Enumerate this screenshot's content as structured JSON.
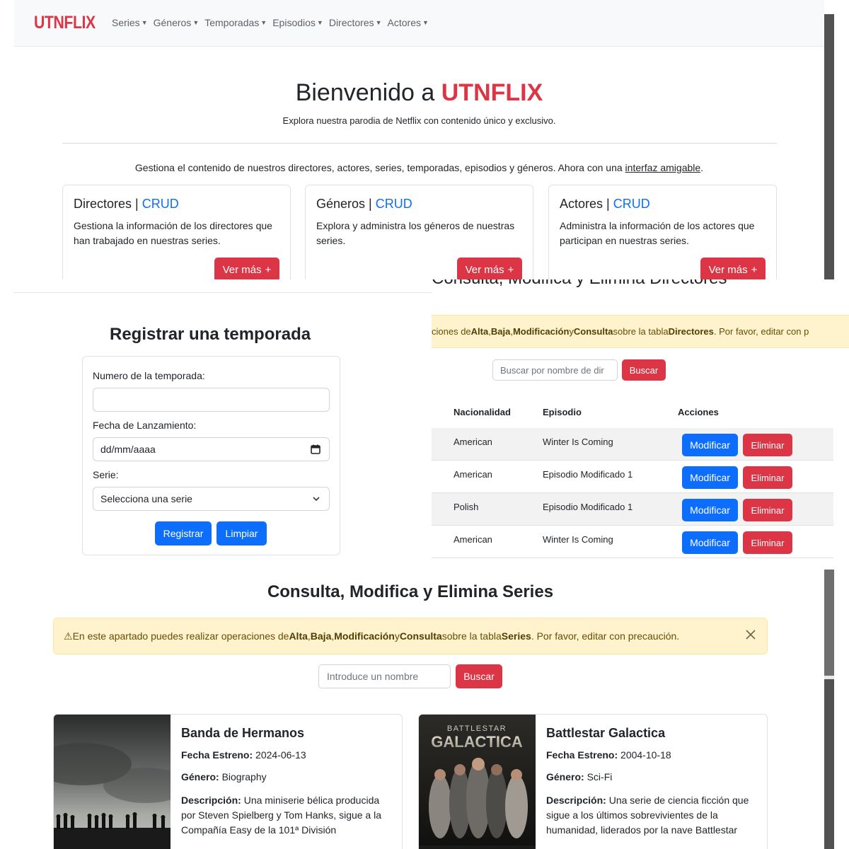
{
  "home": {
    "brand": "UTNFLIX",
    "nav": [
      {
        "label": "Series"
      },
      {
        "label": "Géneros"
      },
      {
        "label": "Temporadas"
      },
      {
        "label": "Episodios"
      },
      {
        "label": "Directores"
      },
      {
        "label": "Actores"
      }
    ],
    "hero_title_prefix": "Bienvenido a ",
    "hero_title_brand": "UTNFLIX",
    "hero_subtitle": "Explora nuestra parodia de Netflix con contenido único y exclusivo.",
    "description_prefix": "Gestiona el contenido de nuestros directores, actores, series, temporadas, episodios y géneros. Ahora con una ",
    "description_link": "interfaz amigable",
    "description_suffix": ".",
    "cards": [
      {
        "title": "Directores",
        "separator": " | ",
        "crud": "CRUD",
        "text": "Gestiona la información de los directores que han trabajado en nuestras series.",
        "button": "Ver más"
      },
      {
        "title": "Géneros",
        "separator": " | ",
        "crud": "CRUD",
        "text": "Explora y administra los géneros de nuestras series.",
        "button": "Ver más"
      },
      {
        "title": "Actores",
        "separator": " | ",
        "crud": "CRUD",
        "text": "Administra la información de los actores que participan en nuestras series.",
        "button": "Ver más"
      }
    ]
  },
  "temporada_form": {
    "title": "Registrar una temporada",
    "numero_label": "Numero de la temporada:",
    "numero_value": "",
    "fecha_label": "Fecha de Lanzamiento:",
    "fecha_placeholder": "dd/mm/aaaa",
    "serie_label": "Serie:",
    "serie_selected": "Selecciona una serie",
    "register_button": "Registrar",
    "clear_button": "Limpiar"
  },
  "directores": {
    "title_partial": "Consulta, Modifica y Elimina Directores",
    "alert_parts": {
      "p1": "ciones de ",
      "alta": "Alta",
      "c1": ", ",
      "baja": "Baja",
      "c2": ", ",
      "mod": "Modificación",
      "y": " y ",
      "consulta": "Consulta",
      "p2": " sobre la tabla ",
      "tabla": "Directores",
      "p3": ". Por favor, editar con p"
    },
    "search_placeholder": "Buscar por nombre de dir",
    "search_button": "Buscar",
    "columns": [
      "Nacionalidad",
      "Episodio",
      "Acciones"
    ],
    "rows": [
      {
        "nacionalidad": "American",
        "episodio": "Winter Is Coming",
        "modify": "Modificar",
        "delete": "Eliminar"
      },
      {
        "nacionalidad": "American",
        "episodio": "Episodio Modificado 1",
        "modify": "Modificar",
        "delete": "Eliminar"
      },
      {
        "nacionalidad": "Polish",
        "episodio": "Episodio Modificado 1",
        "modify": "Modificar",
        "delete": "Eliminar"
      },
      {
        "nacionalidad": "American",
        "episodio": "Winter Is Coming",
        "modify": "Modificar",
        "delete": "Eliminar"
      }
    ]
  },
  "series": {
    "title": "Consulta, Modifica y Elimina Series",
    "alert_parts": {
      "icon": "⚠",
      "p1": " En este apartado puedes realizar operaciones de ",
      "alta": "Alta",
      "c1": ", ",
      "baja": "Baja",
      "c2": ", ",
      "mod": "Modificación",
      "y": " y ",
      "consulta": "Consulta",
      "p2": " sobre la tabla ",
      "tabla": "Series",
      "p3": ". Por favor, editar con precaución."
    },
    "search_placeholder": "Introduce un nombre",
    "search_button": "Buscar",
    "cards": [
      {
        "name": "Banda de Hermanos",
        "fecha_label": "Fecha Estreno:",
        "fecha": " 2024-06-13",
        "genero_label": "Género:",
        "genero": " Biography",
        "desc_label": "Descripción:",
        "desc": " Una miniserie bélica producida por Steven Spielberg y Tom Hanks, sigue a la Compañía Easy de la 101ª División"
      },
      {
        "name": "Battlestar Galactica",
        "fecha_label": "Fecha Estreno:",
        "fecha": " 2004-10-18",
        "genero_label": "Género:",
        "genero": " Sci-Fi",
        "desc_label": "Descripción:",
        "desc": " Una serie de ciencia ficción que sigue a los últimos sobrevivientes de la humanidad, liderados por la nave Battlestar",
        "poster_text_top": "BATTLESTAR",
        "poster_text_main": "GALACTICA"
      }
    ]
  },
  "icons": {
    "caret": "caret-down-icon",
    "plus": "plus-icon",
    "calendar": "calendar-icon",
    "chevron": "chevron-down-icon",
    "warning": "warning-icon",
    "close": "close-icon"
  },
  "colors": {
    "brand_red": "#dc3545",
    "primary_blue": "#0d6efd",
    "alert_bg": "#fff3cd"
  }
}
